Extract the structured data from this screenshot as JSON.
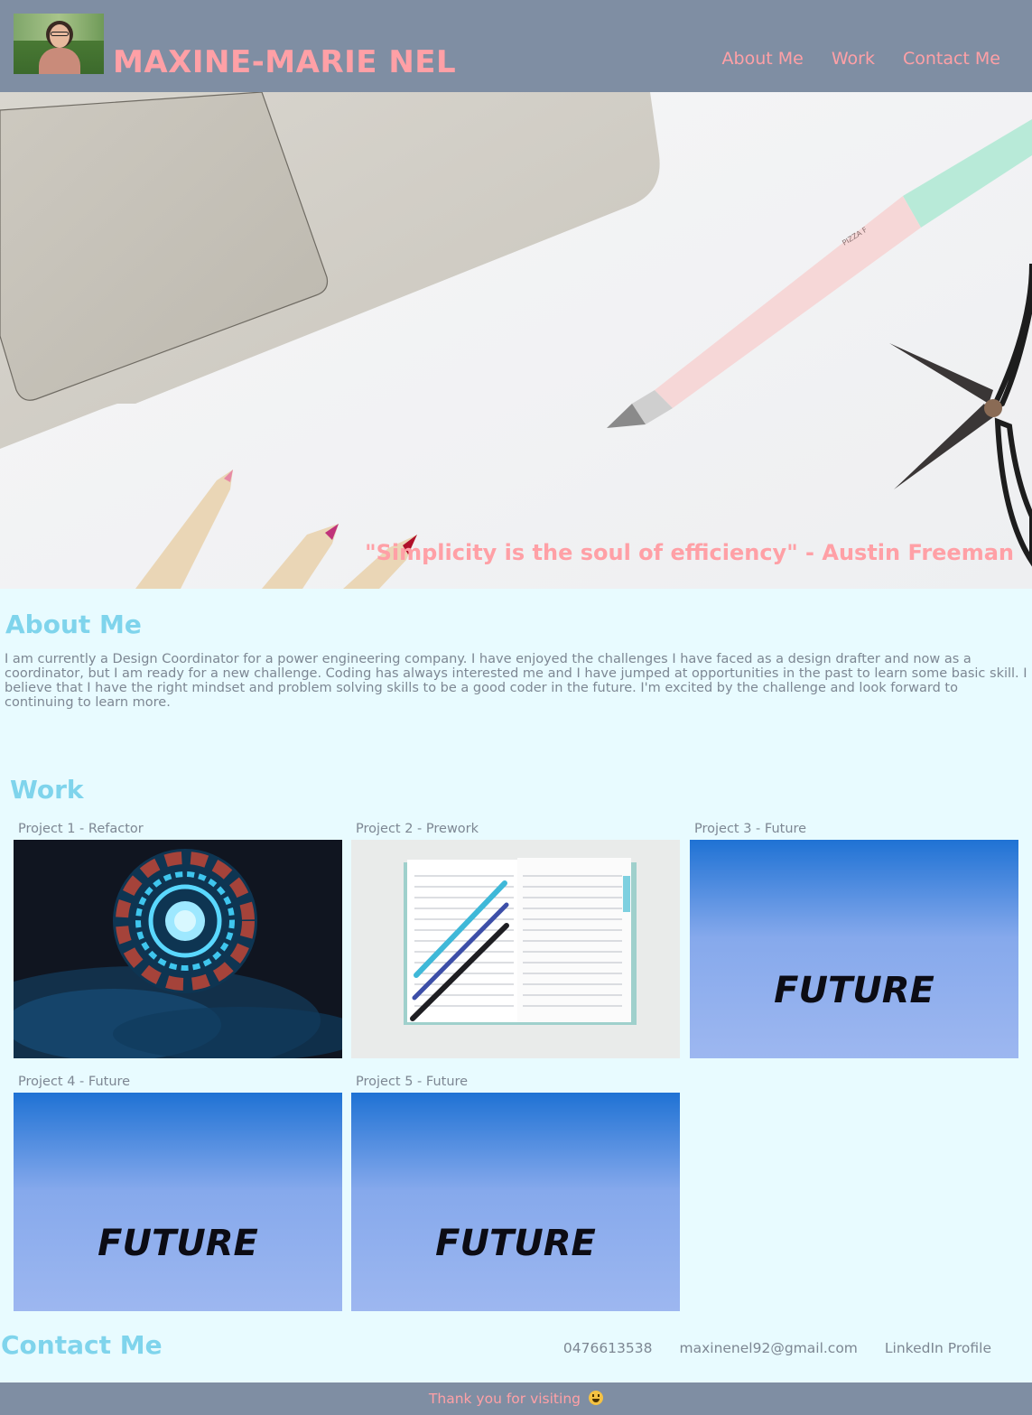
{
  "header": {
    "title": "MAXINE-MARIE NEL",
    "nav": [
      "About Me",
      "Work",
      "Contact Me"
    ]
  },
  "hero": {
    "quote": "\"Simplicity is the soul of efficiency\" - Austin Freeman",
    "pen_text": "PIZZA F"
  },
  "about": {
    "heading": "About Me",
    "text": "I am currently a Design Coordinator for a power engineering company. I have enjoyed the challenges I have faced as a design drafter and now as a coordinator, but I am ready for a new challenge. Coding has always interested me and I have jumped at opportunities in the past to learn some basic skill. I believe that I have the right mindset and problem solving skills to be a good coder in the future. I'm excited by the challenge and look forward to continuing to learn more."
  },
  "work": {
    "heading": "Work",
    "projects": [
      {
        "label": "Project 1 - Refactor"
      },
      {
        "label": "Project 2 - Prework"
      },
      {
        "label": "Project 3 - Future",
        "image_text": "FUTURE"
      },
      {
        "label": "Project 4 - Future",
        "image_text": "FUTURE"
      },
      {
        "label": "Project 5 - Future",
        "image_text": "FUTURE"
      }
    ]
  },
  "contact": {
    "heading": "Contact Me",
    "phone": "0476613538",
    "email": "maxinenel92@gmail.com",
    "linkedin": "LinkedIn Profile"
  },
  "footer": {
    "text": "Thank you for visiting"
  },
  "colors": {
    "header_bg": "#7f8ea3",
    "accent_pink": "#ffa0a6",
    "heading_blue": "#7fd4ec",
    "page_bg": "#e8fbff",
    "body_text": "#7d8793"
  }
}
